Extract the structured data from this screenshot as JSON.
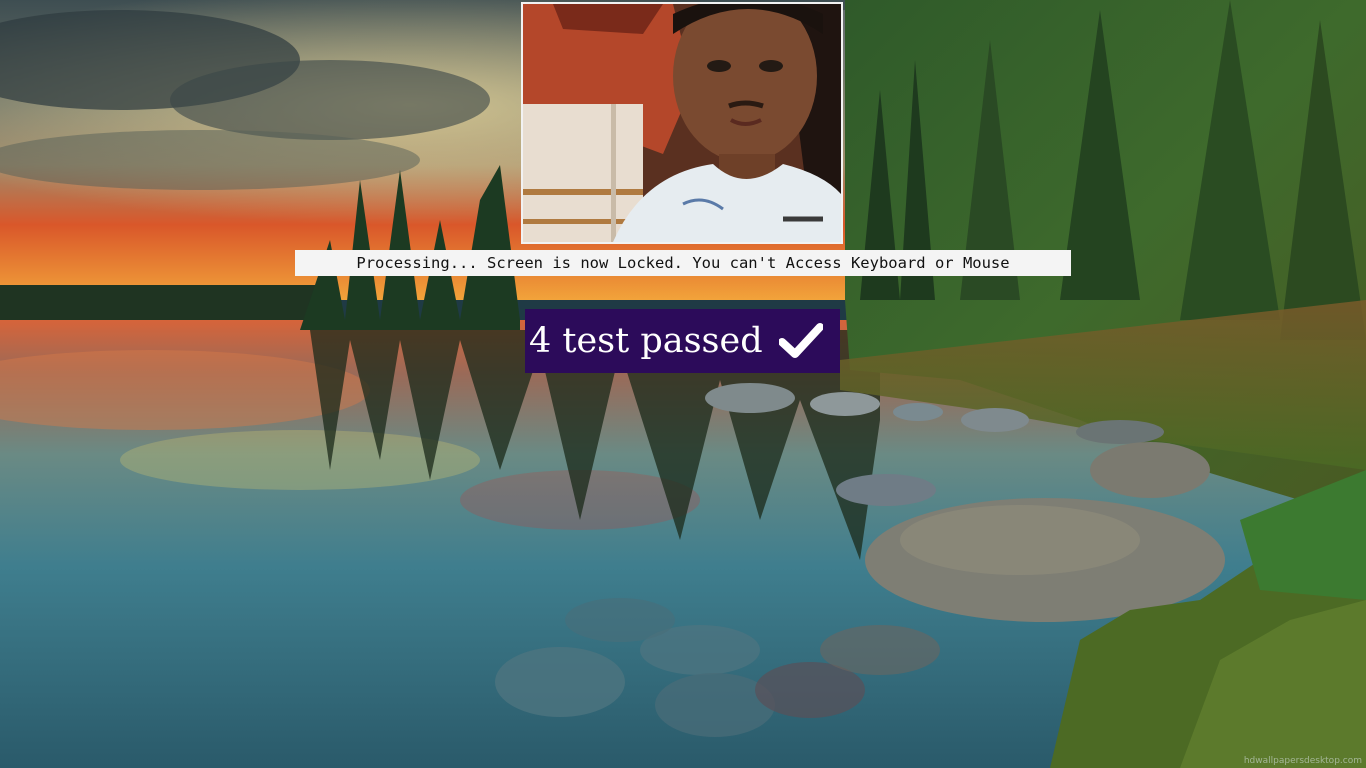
{
  "status": {
    "message": "Processing... Screen is now Locked. You can't Access Keyboard or Mouse"
  },
  "result": {
    "text": "4 test passed",
    "icon": "check-icon",
    "background": "#2c0b5a",
    "color": "#ffffff"
  },
  "webcam": {
    "icon": "person-photo"
  },
  "wallpaper": {
    "watermark": "hdwallpapersdesktop.com"
  }
}
